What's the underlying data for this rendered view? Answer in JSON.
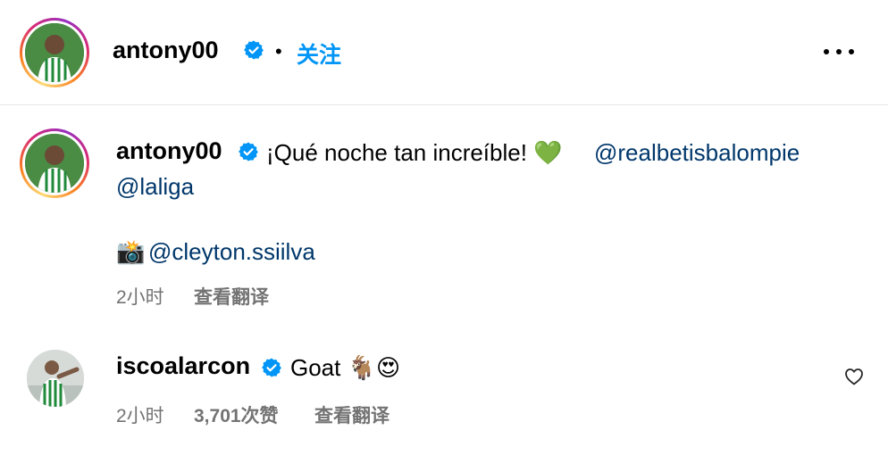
{
  "header": {
    "username": "antony00",
    "separator": "•",
    "follow_label": "关注"
  },
  "caption": {
    "username": "antony00",
    "text": "¡Qué noche tan increíble! 💚",
    "mention_1": "@realbetisbalompie",
    "mention_2": "@laliga",
    "camera_emoji": "📸",
    "mention_3": "@cleyton.ssiilva",
    "time": "2小时",
    "translate_label": "查看翻译"
  },
  "comment": {
    "username": "iscoalarcon",
    "text": "Goat 🐐😍",
    "time": "2小时",
    "likes": "3,701次赞",
    "translate_label": "查看翻译"
  },
  "colors": {
    "link": "#00376b",
    "follow": "#0095f6",
    "meta": "#737373",
    "verified": "#0095f6"
  },
  "icons": [
    "verified-badge-icon",
    "more-options-icon",
    "heart-icon"
  ]
}
